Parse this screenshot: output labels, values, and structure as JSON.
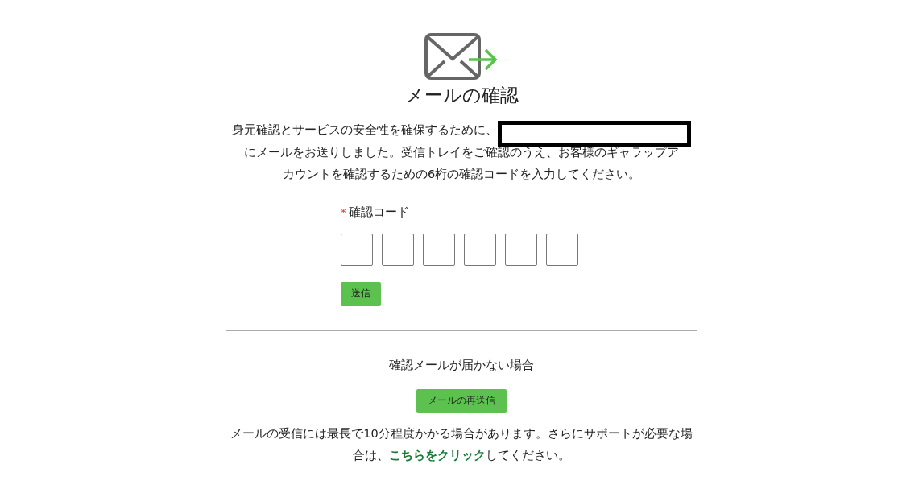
{
  "title": "メールの確認",
  "intro": {
    "before": "身元確認とサービスの安全性を確保するために、",
    "redacted": true,
    "after_lines": [
      "にメールをお送りしました。受信トレイをご確認のうえ、お客様のギャラップア",
      "カウントを確認するための6桁の確認コードを入力してください。"
    ]
  },
  "code": {
    "label": "確認コード",
    "required_mark": "*",
    "digit_fields": [
      {
        "focused": false
      },
      {
        "focused": false
      },
      {
        "focused": false
      },
      {
        "focused": false
      },
      {
        "focused": false
      },
      {
        "focused": false
      }
    ],
    "submit": "送信"
  },
  "resend": {
    "heading": "確認メールが届かない場合",
    "button": "メールの再送信",
    "note_before": "メールの受信には最長で10分程度かかる場合があります。さらにサポートが必要な場合は、",
    "link": "こちらをクリック",
    "note_after": "してください。"
  }
}
